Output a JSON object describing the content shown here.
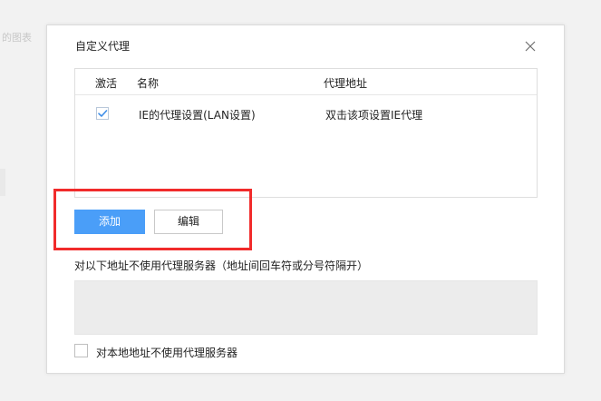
{
  "background": {
    "fragment_text": "的图表"
  },
  "dialog": {
    "title": "自定义代理",
    "close_icon": "close-icon"
  },
  "table": {
    "columns": {
      "active": "激活",
      "name": "名称",
      "address": "代理地址"
    },
    "rows": [
      {
        "checked": true,
        "name": "IE的代理设置(LAN设置)",
        "address": "双击该项设置IE代理"
      }
    ]
  },
  "buttons": {
    "add": "添加",
    "edit": "编辑"
  },
  "bypass": {
    "label": "对以下地址不使用代理服务器（地址间回车符或分号符隔开）",
    "value": ""
  },
  "local": {
    "checked": false,
    "label": "对本地地址不使用代理服务器"
  },
  "colors": {
    "primary_button": "#4a9ef8",
    "highlight_box": "#f12b2b",
    "checkmark": "#3d8ee8"
  }
}
